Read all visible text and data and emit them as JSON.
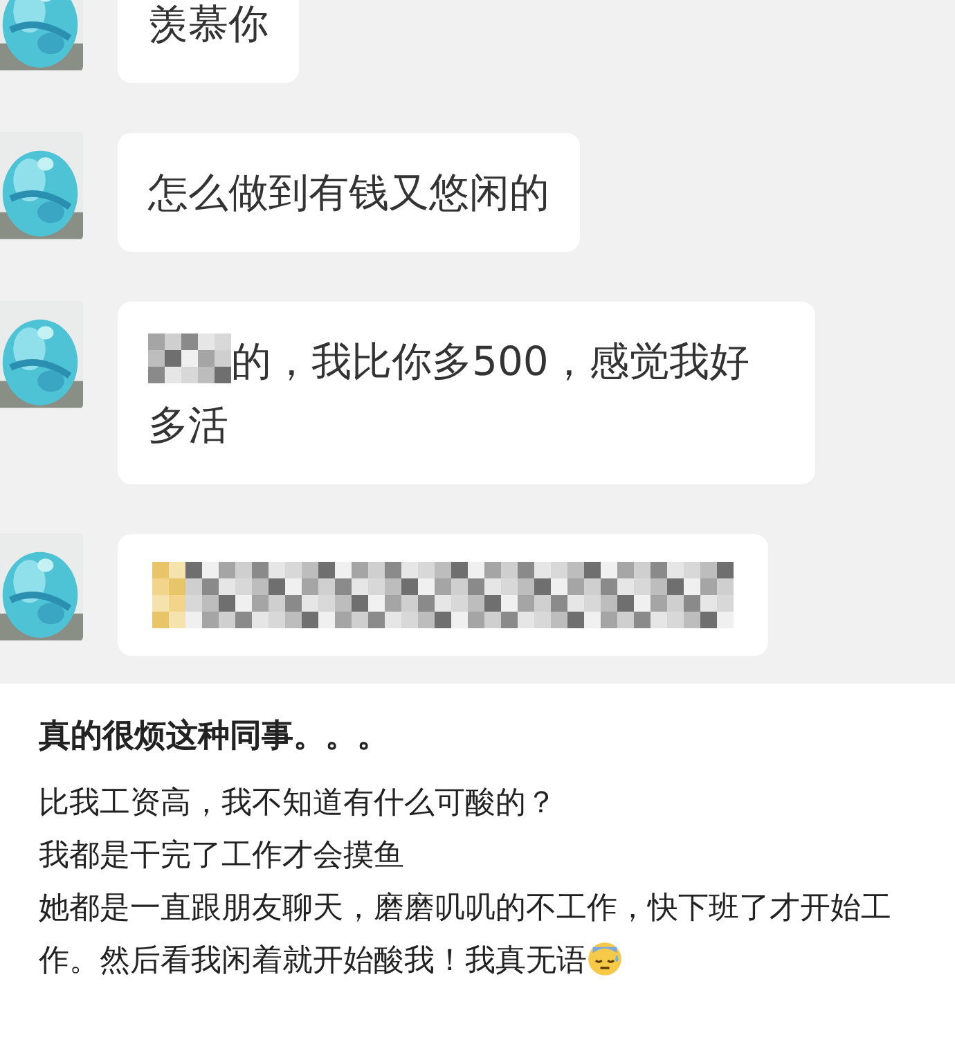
{
  "messages": [
    {
      "kind": "text",
      "text": "羡慕你"
    },
    {
      "kind": "text",
      "text": "怎么做到有钱又悠闲的"
    },
    {
      "kind": "partly_blurred",
      "text": "的，我比你多500，感觉我好多活"
    },
    {
      "kind": "blurred"
    }
  ],
  "post": {
    "title": "真的很烦这种同事。。。",
    "lines": [
      "比我工资高，我不知道有什么可酸的？",
      "我都是干完了工作才会摸鱼",
      "她都是一直跟朋友聊天，磨磨叽叽的不工作，快下班了才开始工作。然后看我闲着就开始酸我！我真无语"
    ]
  }
}
